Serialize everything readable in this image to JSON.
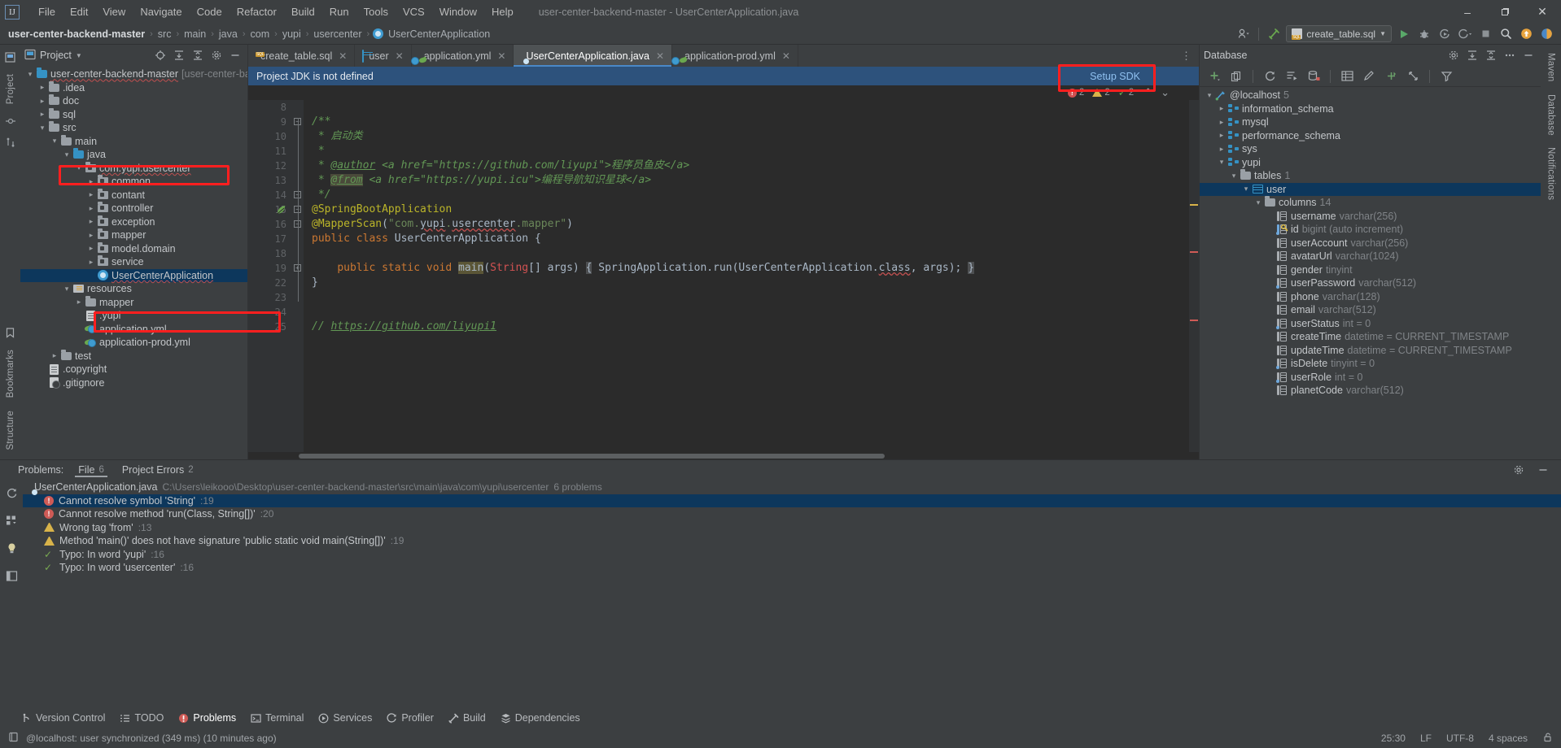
{
  "window": {
    "title": "user-center-backend-master - UserCenterApplication.java",
    "app_icon": "intellij-idea-logo",
    "minimize": "–",
    "maximize": "❐",
    "close": "✕"
  },
  "menu": {
    "items": [
      "File",
      "Edit",
      "View",
      "Navigate",
      "Code",
      "Refactor",
      "Build",
      "Run",
      "Tools",
      "VCS",
      "Window",
      "Help"
    ]
  },
  "breadcrumb": {
    "items": [
      "user-center-backend-master",
      "src",
      "main",
      "java",
      "com",
      "yupi",
      "usercenter",
      "UserCenterApplication"
    ],
    "separator": "›"
  },
  "toolbar": {
    "run_config": "create_table.sql",
    "icons": [
      "user-avatar-icon",
      "build-hammer-icon",
      "run-icon",
      "debug-icon",
      "run-coverage-icon",
      "profile-icon",
      "stop-icon",
      "search-icon",
      "updates-icon",
      "ide-help-icon"
    ]
  },
  "project_panel": {
    "title": "Project",
    "header_icons": [
      "locate-icon",
      "expand-all-icon",
      "collapse-all-icon",
      "settings-icon",
      "hide-icon"
    ],
    "tree": [
      {
        "depth": 0,
        "arrow": "v",
        "icon": "module-folder-icon",
        "label": "user-center-backend-master",
        "sub": "[user-center-backend]",
        "selected": false,
        "squiggle": true
      },
      {
        "depth": 1,
        "arrow": ">",
        "icon": "folder-icon",
        "label": ".idea",
        "sub": "",
        "selected": false
      },
      {
        "depth": 1,
        "arrow": ">",
        "icon": "folder-icon",
        "label": "doc",
        "sub": "",
        "selected": false
      },
      {
        "depth": 1,
        "arrow": ">",
        "icon": "folder-icon",
        "label": "sql",
        "sub": "",
        "selected": false
      },
      {
        "depth": 1,
        "arrow": "v",
        "icon": "folder-icon",
        "label": "src",
        "sub": "",
        "selected": false
      },
      {
        "depth": 2,
        "arrow": "v",
        "icon": "folder-icon",
        "label": "main",
        "sub": "",
        "selected": false
      },
      {
        "depth": 3,
        "arrow": "v",
        "icon": "source-folder-icon",
        "label": "java",
        "sub": "",
        "selected": false,
        "highlight": true
      },
      {
        "depth": 4,
        "arrow": "v",
        "icon": "package-icon",
        "label": "com.yupi.usercenter",
        "sub": "",
        "selected": false,
        "squiggle": true
      },
      {
        "depth": 5,
        "arrow": ">",
        "icon": "package-icon",
        "label": "common",
        "sub": "",
        "selected": false
      },
      {
        "depth": 5,
        "arrow": ">",
        "icon": "package-icon",
        "label": "contant",
        "sub": "",
        "selected": false
      },
      {
        "depth": 5,
        "arrow": ">",
        "icon": "package-icon",
        "label": "controller",
        "sub": "",
        "selected": false
      },
      {
        "depth": 5,
        "arrow": ">",
        "icon": "package-icon",
        "label": "exception",
        "sub": "",
        "selected": false
      },
      {
        "depth": 5,
        "arrow": ">",
        "icon": "package-icon",
        "label": "mapper",
        "sub": "",
        "selected": false
      },
      {
        "depth": 5,
        "arrow": ">",
        "icon": "package-icon",
        "label": "model.domain",
        "sub": "",
        "selected": false
      },
      {
        "depth": 5,
        "arrow": ">",
        "icon": "package-icon",
        "label": "service",
        "sub": "",
        "selected": false
      },
      {
        "depth": 5,
        "arrow": "",
        "icon": "java-class-icon",
        "label": "UserCenterApplication",
        "sub": "",
        "selected": true,
        "squiggle": true,
        "highlight": true
      },
      {
        "depth": 3,
        "arrow": "v",
        "icon": "resources-folder-icon",
        "label": "resources",
        "sub": "",
        "selected": false
      },
      {
        "depth": 4,
        "arrow": ">",
        "icon": "folder-icon",
        "label": "mapper",
        "sub": "",
        "selected": false
      },
      {
        "depth": 4,
        "arrow": "",
        "icon": "file-icon",
        "label": ".yupi",
        "sub": "",
        "selected": false
      },
      {
        "depth": 4,
        "arrow": "",
        "icon": "yaml-file-icon",
        "label": "application.yml",
        "sub": "",
        "selected": false
      },
      {
        "depth": 4,
        "arrow": "",
        "icon": "yaml-file-icon",
        "label": "application-prod.yml",
        "sub": "",
        "selected": false
      },
      {
        "depth": 2,
        "arrow": ">",
        "icon": "folder-icon",
        "label": "test",
        "sub": "",
        "selected": false
      },
      {
        "depth": 1,
        "arrow": "",
        "icon": "file-icon",
        "label": ".copyright",
        "sub": "",
        "selected": false
      },
      {
        "depth": 1,
        "arrow": "",
        "icon": "gitignore-icon",
        "label": ".gitignore",
        "sub": "",
        "selected": false
      }
    ]
  },
  "editor": {
    "tabs": [
      {
        "label": "create_table.sql",
        "icon": "sql-file-icon",
        "active": false,
        "closable": true
      },
      {
        "label": "user",
        "icon": "db-table-icon",
        "active": false,
        "closable": true
      },
      {
        "label": "application.yml",
        "icon": "yaml-file-icon",
        "active": false,
        "closable": true
      },
      {
        "label": "UserCenterApplication.java",
        "icon": "java-class-icon",
        "active": true,
        "closable": true
      },
      {
        "label": "application-prod.yml",
        "icon": "yaml-file-icon",
        "active": false,
        "closable": true
      }
    ],
    "notification": {
      "message": "Project JDK is not defined",
      "action": "Setup SDK"
    },
    "inspection": {
      "errors": "2",
      "warnings": "2",
      "checks": "2",
      "up_arrow": "⌃",
      "down_arrow": "⌄"
    },
    "line_numbers": [
      "8",
      "9",
      "10",
      "11",
      "12",
      "13",
      "14",
      "15",
      "16",
      "17",
      "18",
      "19",
      "22",
      "23",
      "24",
      "25"
    ],
    "code_lines": [
      {
        "n": "8",
        "text": ""
      },
      {
        "n": "9",
        "text": "/**"
      },
      {
        "n": "10",
        "text": " * 启动类"
      },
      {
        "n": "11",
        "text": " *"
      },
      {
        "n": "12",
        "text": " * @author <a href=\"https://github.com/liyupi\">程序员鱼皮</a>"
      },
      {
        "n": "13",
        "text": " * @from <a href=\"https://yupi.icu\">编程导航知识星球</a>"
      },
      {
        "n": "14",
        "text": " */"
      },
      {
        "n": "15",
        "text": "@SpringBootApplication"
      },
      {
        "n": "16",
        "text": "@MapperScan(\"com.yupi.usercenter.mapper\")"
      },
      {
        "n": "17",
        "text": "public class UserCenterApplication {"
      },
      {
        "n": "18",
        "text": ""
      },
      {
        "n": "19",
        "text": "    public static void main(String[] args) { SpringApplication.run(UserCenterApplication.class, args); }"
      },
      {
        "n": "22",
        "text": "}"
      },
      {
        "n": "23",
        "text": ""
      },
      {
        "n": "24",
        "text": ""
      },
      {
        "n": "25",
        "text": "// https://github.com/liyupi1"
      }
    ]
  },
  "database_panel": {
    "title": "Database",
    "toolbar_icons": [
      "add-icon",
      "copy-icon",
      "refresh-icon",
      "run-query-icon",
      "db-sync-icon",
      "table-editor-icon",
      "edit-icon",
      "jump-icon",
      "expand-icon",
      "filter-icon"
    ],
    "header_icons": [
      "settings-gear-icon",
      "expand-all-icon",
      "collapse-all-icon",
      "settings-icon",
      "hide-icon"
    ],
    "tree": [
      {
        "depth": 0,
        "arrow": "v",
        "icon": "datasource-icon",
        "label": "@localhost",
        "sub": "5",
        "selected": false
      },
      {
        "depth": 1,
        "arrow": ">",
        "icon": "schema-icon",
        "label": "information_schema",
        "sub": "",
        "selected": false
      },
      {
        "depth": 1,
        "arrow": ">",
        "icon": "schema-icon",
        "label": "mysql",
        "sub": "",
        "selected": false
      },
      {
        "depth": 1,
        "arrow": ">",
        "icon": "schema-icon",
        "label": "performance_schema",
        "sub": "",
        "selected": false
      },
      {
        "depth": 1,
        "arrow": ">",
        "icon": "schema-icon",
        "label": "sys",
        "sub": "",
        "selected": false
      },
      {
        "depth": 1,
        "arrow": "v",
        "icon": "schema-icon",
        "label": "yupi",
        "sub": "",
        "selected": false
      },
      {
        "depth": 2,
        "arrow": "v",
        "icon": "folder-icon",
        "label": "tables",
        "sub": "1",
        "selected": false
      },
      {
        "depth": 3,
        "arrow": "v",
        "icon": "db-table-icon",
        "label": "user",
        "sub": "",
        "selected": true
      },
      {
        "depth": 4,
        "arrow": "v",
        "icon": "folder-icon",
        "label": "columns",
        "sub": "14",
        "selected": false
      },
      {
        "depth": 5,
        "arrow": "",
        "icon": "column-icon",
        "label": "username",
        "sub": "varchar(256)",
        "selected": false
      },
      {
        "depth": 5,
        "arrow": "",
        "icon": "primary-key-column-icon",
        "label": "id",
        "sub": "bigint (auto increment)",
        "selected": false
      },
      {
        "depth": 5,
        "arrow": "",
        "icon": "column-icon",
        "label": "userAccount",
        "sub": "varchar(256)",
        "selected": false
      },
      {
        "depth": 5,
        "arrow": "",
        "icon": "column-icon",
        "label": "avatarUrl",
        "sub": "varchar(1024)",
        "selected": false
      },
      {
        "depth": 5,
        "arrow": "",
        "icon": "column-icon",
        "label": "gender",
        "sub": "tinyint",
        "selected": false
      },
      {
        "depth": 5,
        "arrow": "",
        "icon": "column-icon-notnull",
        "label": "userPassword",
        "sub": "varchar(512)",
        "selected": false
      },
      {
        "depth": 5,
        "arrow": "",
        "icon": "column-icon",
        "label": "phone",
        "sub": "varchar(128)",
        "selected": false
      },
      {
        "depth": 5,
        "arrow": "",
        "icon": "column-icon",
        "label": "email",
        "sub": "varchar(512)",
        "selected": false
      },
      {
        "depth": 5,
        "arrow": "",
        "icon": "column-icon-notnull",
        "label": "userStatus",
        "sub": "int = 0",
        "selected": false
      },
      {
        "depth": 5,
        "arrow": "",
        "icon": "column-icon",
        "label": "createTime",
        "sub": "datetime = CURRENT_TIMESTAMP",
        "selected": false
      },
      {
        "depth": 5,
        "arrow": "",
        "icon": "column-icon",
        "label": "updateTime",
        "sub": "datetime = CURRENT_TIMESTAMP",
        "selected": false
      },
      {
        "depth": 5,
        "arrow": "",
        "icon": "column-icon-notnull",
        "label": "isDelete",
        "sub": "tinyint = 0",
        "selected": false
      },
      {
        "depth": 5,
        "arrow": "",
        "icon": "column-icon-notnull",
        "label": "userRole",
        "sub": "int = 0",
        "selected": false
      },
      {
        "depth": 5,
        "arrow": "",
        "icon": "column-icon",
        "label": "planetCode",
        "sub": "varchar(512)",
        "selected": false
      }
    ]
  },
  "problems_panel": {
    "label": "Problems:",
    "tabs": [
      {
        "label": "File",
        "count": "6",
        "active": true
      },
      {
        "label": "Project Errors",
        "count": "2",
        "active": false
      }
    ],
    "file_row": {
      "icon": "java-class-icon",
      "name": "UserCenterApplication.java",
      "path": "C:\\Users\\leikooo\\Desktop\\user-center-backend-master\\src\\main\\java\\com\\yupi\\usercenter",
      "count": "6 problems"
    },
    "items": [
      {
        "severity": "error",
        "text": "Cannot resolve symbol 'String'",
        "line": ":19",
        "selected": true
      },
      {
        "severity": "error",
        "text": "Cannot resolve method 'run(Class, String[])'",
        "line": ":20",
        "selected": false
      },
      {
        "severity": "warning",
        "text": "Wrong tag 'from'",
        "line": ":13",
        "selected": false
      },
      {
        "severity": "warning",
        "text": "Method 'main()' does not have signature 'public static void main(String[])'",
        "line": ":19",
        "selected": false
      },
      {
        "severity": "typo",
        "text": "Typo: In word 'yupi'",
        "line": ":16",
        "selected": false
      },
      {
        "severity": "typo",
        "text": "Typo: In word 'usercenter'",
        "line": ":16",
        "selected": false
      }
    ],
    "rail_icons": [
      "rerun-icon",
      "group-by-icon",
      "lightbulb-icon",
      "preview-icon"
    ],
    "header_icons": [
      "settings-gear-icon",
      "hide-icon"
    ]
  },
  "tool_windows": {
    "items": [
      {
        "label": "Version Control",
        "icon": "branch-icon",
        "active": false
      },
      {
        "label": "TODO",
        "icon": "todo-icon",
        "active": false
      },
      {
        "label": "Problems",
        "icon": "problems-error-icon",
        "active": true
      },
      {
        "label": "Terminal",
        "icon": "terminal-icon",
        "active": false
      },
      {
        "label": "Services",
        "icon": "services-icon",
        "active": false
      },
      {
        "label": "Profiler",
        "icon": "profiler-icon",
        "active": false
      },
      {
        "label": "Build",
        "icon": "build-hammer-icon",
        "active": false
      },
      {
        "label": "Dependencies",
        "icon": "dependencies-icon",
        "active": false
      }
    ]
  },
  "left_rail": {
    "top": [
      {
        "label": "Project",
        "icon": "project-icon"
      },
      {
        "label": "Commit",
        "icon": "commit-icon"
      },
      {
        "label": "Pull Requests",
        "icon": "pr-icon"
      }
    ],
    "bottom": [
      {
        "label": "Bookmarks",
        "icon": "bookmarks-icon"
      },
      {
        "label": "Structure",
        "icon": "structure-icon"
      }
    ]
  },
  "right_rail": {
    "items": [
      {
        "label": "Maven",
        "icon": "maven-icon"
      },
      {
        "label": "Database",
        "icon": "database-icon"
      },
      {
        "label": "Notifications",
        "icon": "notifications-icon"
      }
    ]
  },
  "status_bar": {
    "message": "@localhost: user synchronized (349 ms) (10 minutes ago)",
    "icon": "status-book-icon",
    "caret": "25:30",
    "line_separator": "LF",
    "encoding": "UTF-8",
    "indent": "4 spaces",
    "lock": "read-write-lock-icon"
  },
  "colors": {
    "accent_blue": "#4a88c7",
    "notification_blue": "#2d527c",
    "selection_blue": "#0d375c",
    "highlight_red": "#ff1f1f",
    "error_red": "#cf5b56",
    "warning_yellow": "#d8b34a",
    "ok_green": "#6aa84f",
    "editor_bg": "#2b2b2b",
    "panel_bg": "#3c3f41"
  }
}
